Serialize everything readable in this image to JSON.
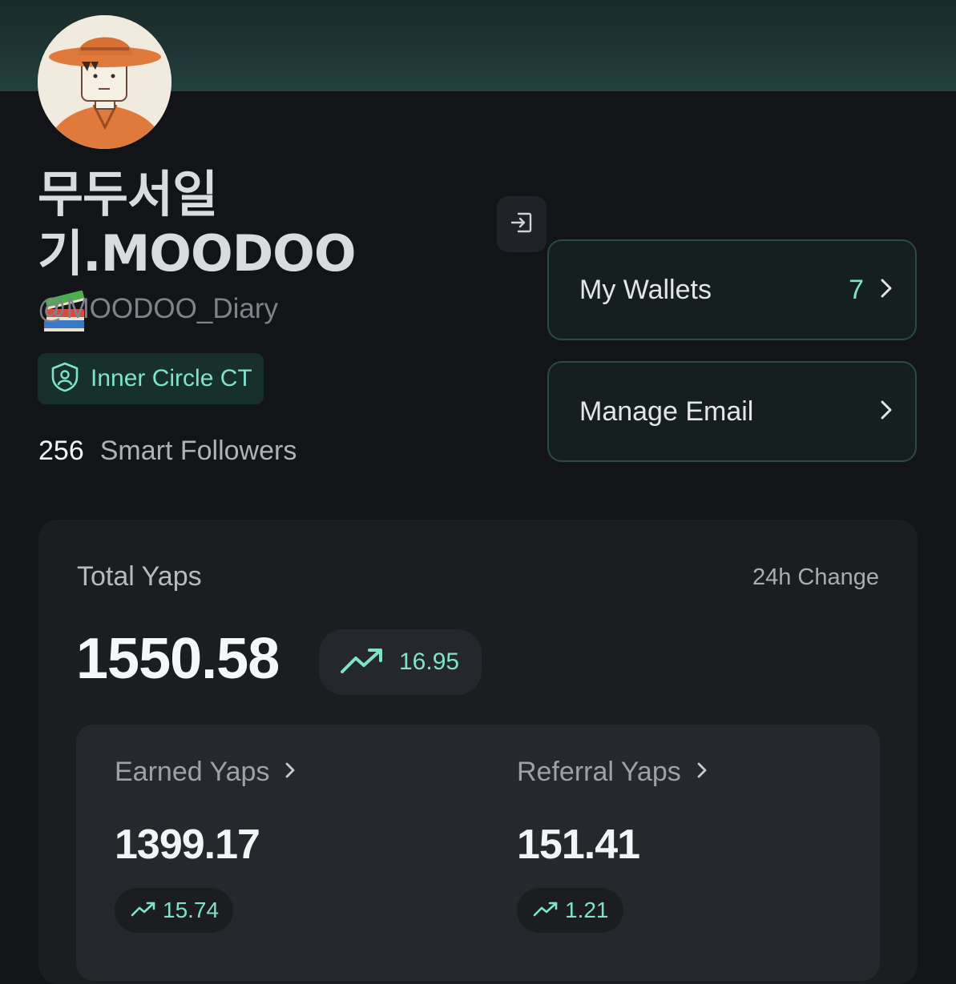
{
  "profile": {
    "name_line1": "무두서일",
    "name_line2": "기.MOODOO",
    "name_emoji_icon": "books-icon",
    "handle": "@MOODOO_Diary",
    "badge_label": "Inner Circle CT",
    "followers_count": "256",
    "followers_label": "Smart Followers"
  },
  "actions": {
    "logout_icon": "logout-icon",
    "wallets_label": "My Wallets",
    "wallets_count": "7",
    "email_label": "Manage Email"
  },
  "yaps": {
    "title": "Total Yaps",
    "change_label": "24h Change",
    "total": "1550.58",
    "total_change": "16.95",
    "earned_label": "Earned Yaps",
    "earned_value": "1399.17",
    "earned_change": "15.74",
    "referral_label": "Referral Yaps",
    "referral_value": "151.41",
    "referral_change": "1.21"
  },
  "colors": {
    "accent": "#7fe3cc",
    "background": "#121418",
    "panel": "#1b1d21"
  }
}
